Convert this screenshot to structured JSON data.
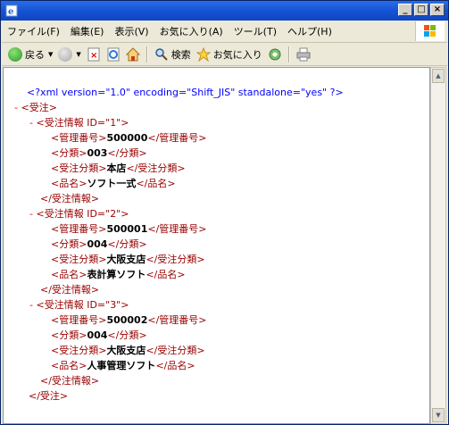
{
  "menu": [
    "ファイル(F)",
    "編集(E)",
    "表示(V)",
    "お気に入り(A)",
    "ツール(T)",
    "ヘルプ(H)"
  ],
  "toolbar": {
    "back": "戻る",
    "search": "検索",
    "favorites": "お気に入り"
  },
  "xml": {
    "declaration": "<?xml version=\"1.0\" encoding=\"Shift_JIS\" standalone=\"yes\" ?>",
    "root_open": "<受注>",
    "root_close": "</受注>",
    "minus": "-",
    "records": [
      {
        "open": "<受注情報 ID=\"1\">",
        "close": "</受注情報>",
        "fields": [
          {
            "open": "<管理番号>",
            "value": "500000",
            "close": "</管理番号>"
          },
          {
            "open": "<分類>",
            "value": "003",
            "close": "</分類>"
          },
          {
            "open": "<受注分類>",
            "value": "本店",
            "close": "</受注分類>"
          },
          {
            "open": "<品名>",
            "value": "ソフト一式",
            "close": "</品名>"
          }
        ]
      },
      {
        "open": "<受注情報 ID=\"2\">",
        "close": "</受注情報>",
        "fields": [
          {
            "open": "<管理番号>",
            "value": "500001",
            "close": "</管理番号>"
          },
          {
            "open": "<分類>",
            "value": "004",
            "close": "</分類>"
          },
          {
            "open": "<受注分類>",
            "value": "大阪支店",
            "close": "</受注分類>"
          },
          {
            "open": "<品名>",
            "value": "表計算ソフト",
            "close": "</品名>"
          }
        ]
      },
      {
        "open": "<受注情報 ID=\"3\">",
        "close": "</受注情報>",
        "fields": [
          {
            "open": "<管理番号>",
            "value": "500002",
            "close": "</管理番号>"
          },
          {
            "open": "<分類>",
            "value": "004",
            "close": "</分類>"
          },
          {
            "open": "<受注分類>",
            "value": "大阪支店",
            "close": "</受注分類>"
          },
          {
            "open": "<品名>",
            "value": "人事管理ソフト",
            "close": "</品名>"
          }
        ]
      }
    ]
  }
}
